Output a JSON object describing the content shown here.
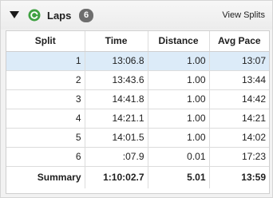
{
  "header": {
    "title": "Laps",
    "badge": "6",
    "view_splits": "View Splits",
    "icons": {
      "toggle": "disclosure-triangle-down-icon",
      "laps": "refresh-green-icon"
    },
    "accent": "#3fa142"
  },
  "table": {
    "columns": [
      "Split",
      "Time",
      "Distance",
      "Avg Pace"
    ],
    "rows": [
      {
        "split": "1",
        "time": "13:06.8",
        "distance": "1.00",
        "pace": "13:07"
      },
      {
        "split": "2",
        "time": "13:43.6",
        "distance": "1.00",
        "pace": "13:44"
      },
      {
        "split": "3",
        "time": "14:41.8",
        "distance": "1.00",
        "pace": "14:42"
      },
      {
        "split": "4",
        "time": "14:21.1",
        "distance": "1.00",
        "pace": "14:21"
      },
      {
        "split": "5",
        "time": "14:01.5",
        "distance": "1.00",
        "pace": "14:02"
      },
      {
        "split": "6",
        "time": ":07.9",
        "distance": "0.01",
        "pace": "17:23"
      }
    ],
    "summary": {
      "label": "Summary",
      "time": "1:10:02.7",
      "distance": "5.01",
      "pace": "13:59"
    },
    "selected_row_color": "#dcebf8"
  }
}
